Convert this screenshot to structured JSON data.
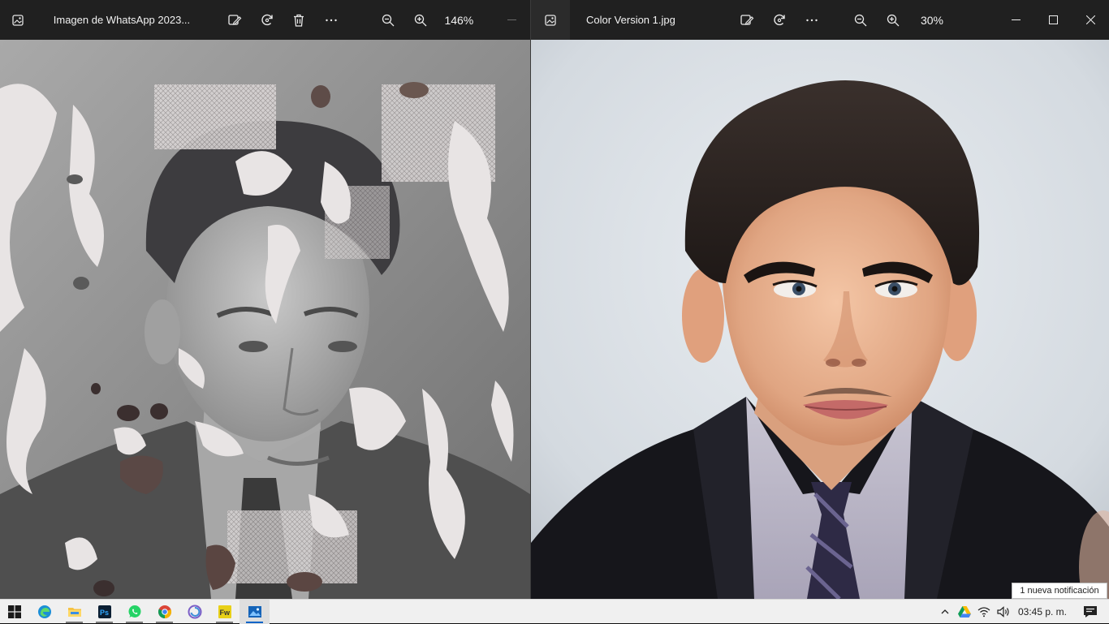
{
  "left_window": {
    "title": "Imagen de WhatsApp 2023...",
    "zoom": "146%",
    "app_icon": "photos-app-icon",
    "toolbar_icons": [
      "edit-image-icon",
      "rotate-icon",
      "delete-icon",
      "more-icon",
      "zoom-out-icon",
      "zoom-in-icon"
    ]
  },
  "right_window": {
    "title": "Color Version 1.jpg",
    "zoom": "30%",
    "app_icon": "photos-app-icon",
    "toolbar_icons": [
      "edit-image-icon",
      "rotate-icon",
      "more-icon",
      "zoom-out-icon",
      "zoom-in-icon"
    ],
    "window_controls": [
      "minimize-icon",
      "maximize-icon",
      "close-icon"
    ]
  },
  "taskbar": {
    "apps": [
      {
        "name": "edge-icon",
        "running": false
      },
      {
        "name": "file-explorer-icon",
        "running": true
      },
      {
        "name": "photoshop-icon",
        "running": true
      },
      {
        "name": "whatsapp-icon",
        "running": true
      },
      {
        "name": "chrome-icon",
        "running": true
      },
      {
        "name": "app-swirl-icon",
        "running": false
      },
      {
        "name": "fireworks-icon",
        "running": true
      },
      {
        "name": "photos-icon",
        "running": true,
        "active": true
      }
    ],
    "tray_icons": [
      "chevron-up-icon",
      "google-drive-icon",
      "wifi-icon",
      "volume-icon"
    ],
    "clock": "03:45 p. m.",
    "notification_tooltip": "1 nueva notificación"
  },
  "colors": {
    "titlebar": "#202020",
    "taskbar": "#f0f0f0",
    "accent": "#0a64c8"
  }
}
